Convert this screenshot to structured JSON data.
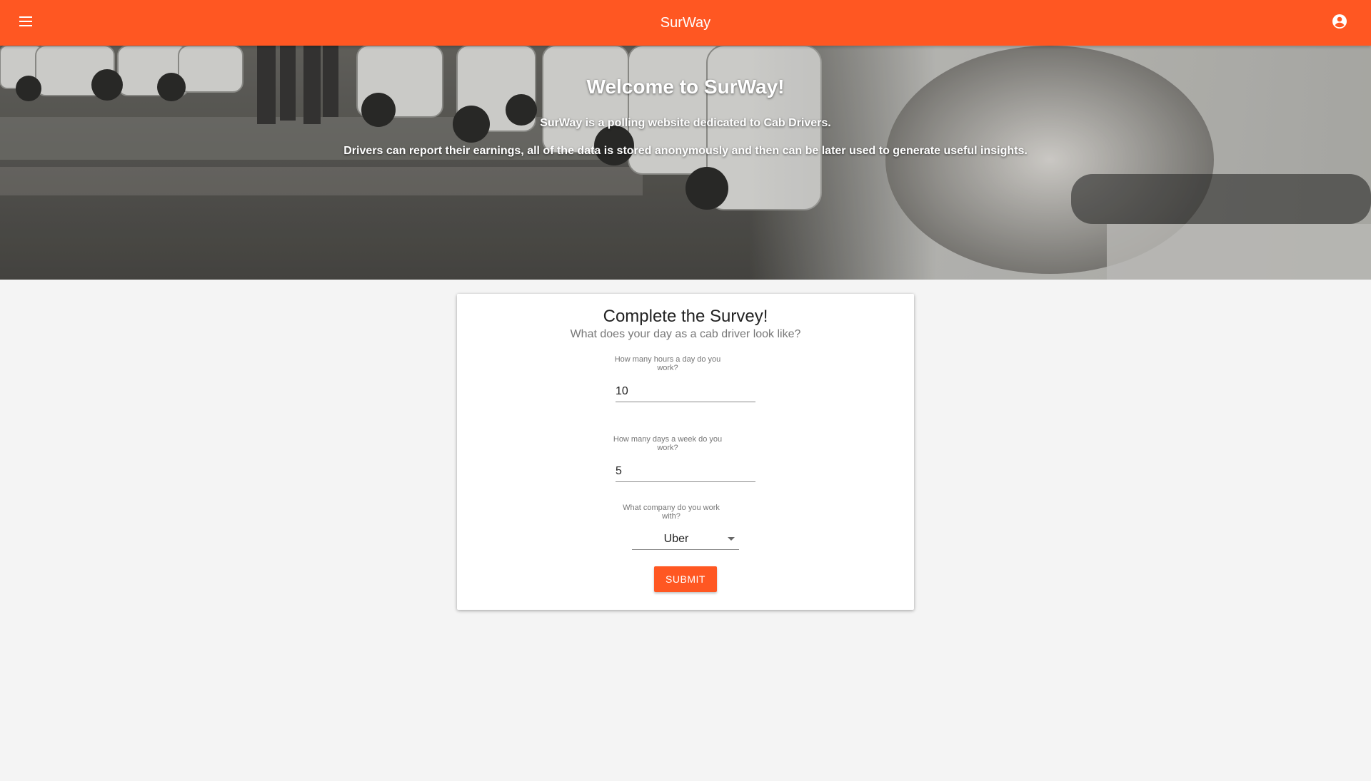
{
  "colors": {
    "primary": "#ff5722",
    "background": "#f4f4f4",
    "card": "#ffffff"
  },
  "appbar": {
    "title": "SurWay",
    "menu_icon": "menu-icon",
    "account_icon": "account-circle-icon"
  },
  "hero": {
    "title": "Welcome to SurWay!",
    "line1": "SurWay is a polling website dedicated to Cab Drivers.",
    "line2": "Drivers can report their earnings, all of the data is stored anonymously and then can be later used to generate useful insights."
  },
  "survey": {
    "title": "Complete the Survey!",
    "subtitle": "What does your day as a cab driver look like?",
    "hours": {
      "label": "How many hours a day do you work?",
      "value": "10"
    },
    "days": {
      "label": "How many days a week do you work?",
      "value": "5"
    },
    "company": {
      "label": "What company do you work with?",
      "value": "Uber"
    },
    "submit_label": "SUBMIT"
  }
}
